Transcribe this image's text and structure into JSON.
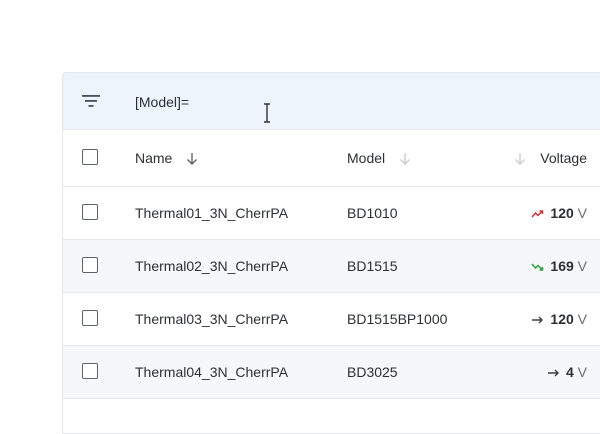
{
  "filter": {
    "value": "[Model]=",
    "icon": "filter-icon"
  },
  "columns": {
    "name": "Name",
    "model": "Model",
    "voltage": "Voltage"
  },
  "rows": [
    {
      "name": "Thermal01_3N_CherrPA",
      "model": "BD1010",
      "voltage": "120",
      "unit": "V",
      "trend": "trend-up-icon",
      "trend_color": "#d0343a"
    },
    {
      "name": "Thermal02_3N_CherrPA",
      "model": "BD1515",
      "voltage": "169",
      "unit": "V",
      "trend": "trend-down-icon",
      "trend_color": "#2f9e44"
    },
    {
      "name": "Thermal03_3N_CherrPA",
      "model": "BD1515BP1000",
      "voltage": "120",
      "unit": "V",
      "trend": "trend-flat-icon",
      "trend_color": "#3a3d42"
    },
    {
      "name": "Thermal04_3N_CherrPA",
      "model": "BD3025",
      "voltage": "4",
      "unit": "V",
      "trend": "trend-flat-icon",
      "trend_color": "#3a3d42"
    }
  ]
}
